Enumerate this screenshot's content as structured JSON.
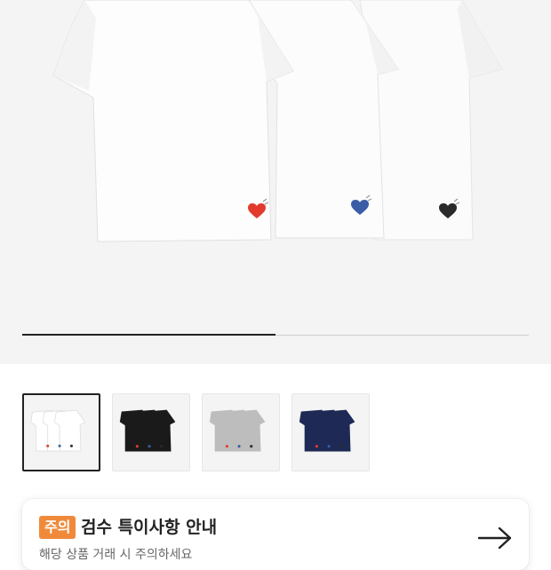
{
  "gallery": {
    "progress": 0.5,
    "thumbnails": [
      {
        "color_name": "white",
        "color": "#ffffff",
        "selected": true
      },
      {
        "color_name": "black",
        "color": "#1a1a1a",
        "selected": false
      },
      {
        "color_name": "gray",
        "color": "#bdbdbd",
        "selected": false
      },
      {
        "color_name": "navy",
        "color": "#1e2a55",
        "selected": false
      }
    ]
  },
  "notice": {
    "badge": "주의",
    "title": "검수 특이사항 안내",
    "subtitle": "해당 상품 거래 시 주의하세요",
    "badge_color": "#f08a3a"
  }
}
